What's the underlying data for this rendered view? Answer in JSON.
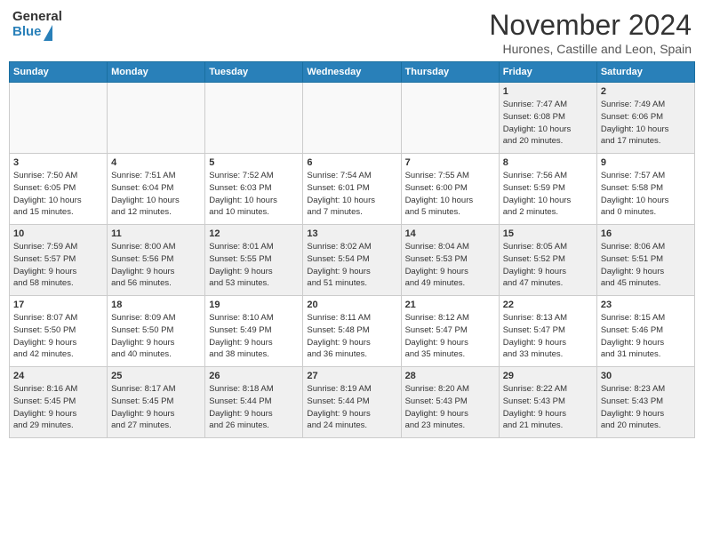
{
  "header": {
    "logo_general": "General",
    "logo_blue": "Blue",
    "month": "November 2024",
    "location": "Hurones, Castille and Leon, Spain"
  },
  "days_of_week": [
    "Sunday",
    "Monday",
    "Tuesday",
    "Wednesday",
    "Thursday",
    "Friday",
    "Saturday"
  ],
  "weeks": [
    [
      {
        "day": "",
        "info": "",
        "empty": true
      },
      {
        "day": "",
        "info": "",
        "empty": true
      },
      {
        "day": "",
        "info": "",
        "empty": true
      },
      {
        "day": "",
        "info": "",
        "empty": true
      },
      {
        "day": "",
        "info": "",
        "empty": true
      },
      {
        "day": "1",
        "info": "Sunrise: 7:47 AM\nSunset: 6:08 PM\nDaylight: 10 hours\nand 20 minutes."
      },
      {
        "day": "2",
        "info": "Sunrise: 7:49 AM\nSunset: 6:06 PM\nDaylight: 10 hours\nand 17 minutes."
      }
    ],
    [
      {
        "day": "3",
        "info": "Sunrise: 7:50 AM\nSunset: 6:05 PM\nDaylight: 10 hours\nand 15 minutes."
      },
      {
        "day": "4",
        "info": "Sunrise: 7:51 AM\nSunset: 6:04 PM\nDaylight: 10 hours\nand 12 minutes."
      },
      {
        "day": "5",
        "info": "Sunrise: 7:52 AM\nSunset: 6:03 PM\nDaylight: 10 hours\nand 10 minutes."
      },
      {
        "day": "6",
        "info": "Sunrise: 7:54 AM\nSunset: 6:01 PM\nDaylight: 10 hours\nand 7 minutes."
      },
      {
        "day": "7",
        "info": "Sunrise: 7:55 AM\nSunset: 6:00 PM\nDaylight: 10 hours\nand 5 minutes."
      },
      {
        "day": "8",
        "info": "Sunrise: 7:56 AM\nSunset: 5:59 PM\nDaylight: 10 hours\nand 2 minutes."
      },
      {
        "day": "9",
        "info": "Sunrise: 7:57 AM\nSunset: 5:58 PM\nDaylight: 10 hours\nand 0 minutes."
      }
    ],
    [
      {
        "day": "10",
        "info": "Sunrise: 7:59 AM\nSunset: 5:57 PM\nDaylight: 9 hours\nand 58 minutes."
      },
      {
        "day": "11",
        "info": "Sunrise: 8:00 AM\nSunset: 5:56 PM\nDaylight: 9 hours\nand 56 minutes."
      },
      {
        "day": "12",
        "info": "Sunrise: 8:01 AM\nSunset: 5:55 PM\nDaylight: 9 hours\nand 53 minutes."
      },
      {
        "day": "13",
        "info": "Sunrise: 8:02 AM\nSunset: 5:54 PM\nDaylight: 9 hours\nand 51 minutes."
      },
      {
        "day": "14",
        "info": "Sunrise: 8:04 AM\nSunset: 5:53 PM\nDaylight: 9 hours\nand 49 minutes."
      },
      {
        "day": "15",
        "info": "Sunrise: 8:05 AM\nSunset: 5:52 PM\nDaylight: 9 hours\nand 47 minutes."
      },
      {
        "day": "16",
        "info": "Sunrise: 8:06 AM\nSunset: 5:51 PM\nDaylight: 9 hours\nand 45 minutes."
      }
    ],
    [
      {
        "day": "17",
        "info": "Sunrise: 8:07 AM\nSunset: 5:50 PM\nDaylight: 9 hours\nand 42 minutes."
      },
      {
        "day": "18",
        "info": "Sunrise: 8:09 AM\nSunset: 5:50 PM\nDaylight: 9 hours\nand 40 minutes."
      },
      {
        "day": "19",
        "info": "Sunrise: 8:10 AM\nSunset: 5:49 PM\nDaylight: 9 hours\nand 38 minutes."
      },
      {
        "day": "20",
        "info": "Sunrise: 8:11 AM\nSunset: 5:48 PM\nDaylight: 9 hours\nand 36 minutes."
      },
      {
        "day": "21",
        "info": "Sunrise: 8:12 AM\nSunset: 5:47 PM\nDaylight: 9 hours\nand 35 minutes."
      },
      {
        "day": "22",
        "info": "Sunrise: 8:13 AM\nSunset: 5:47 PM\nDaylight: 9 hours\nand 33 minutes."
      },
      {
        "day": "23",
        "info": "Sunrise: 8:15 AM\nSunset: 5:46 PM\nDaylight: 9 hours\nand 31 minutes."
      }
    ],
    [
      {
        "day": "24",
        "info": "Sunrise: 8:16 AM\nSunset: 5:45 PM\nDaylight: 9 hours\nand 29 minutes."
      },
      {
        "day": "25",
        "info": "Sunrise: 8:17 AM\nSunset: 5:45 PM\nDaylight: 9 hours\nand 27 minutes."
      },
      {
        "day": "26",
        "info": "Sunrise: 8:18 AM\nSunset: 5:44 PM\nDaylight: 9 hours\nand 26 minutes."
      },
      {
        "day": "27",
        "info": "Sunrise: 8:19 AM\nSunset: 5:44 PM\nDaylight: 9 hours\nand 24 minutes."
      },
      {
        "day": "28",
        "info": "Sunrise: 8:20 AM\nSunset: 5:43 PM\nDaylight: 9 hours\nand 23 minutes."
      },
      {
        "day": "29",
        "info": "Sunrise: 8:22 AM\nSunset: 5:43 PM\nDaylight: 9 hours\nand 21 minutes."
      },
      {
        "day": "30",
        "info": "Sunrise: 8:23 AM\nSunset: 5:43 PM\nDaylight: 9 hours\nand 20 minutes."
      }
    ]
  ]
}
